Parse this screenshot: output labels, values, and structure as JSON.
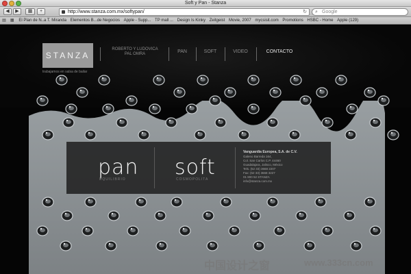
{
  "window": {
    "title": "Soft y Pan - Stanza"
  },
  "toolbar": {
    "url": "http://www.stanza.com.mx/softypan/",
    "search_placeholder": "Google"
  },
  "bookmarks": [
    "El Plan de N..a T. Miranda",
    "Elementos B...de Negocios",
    "Apple - Supp...",
    "TP mall ...",
    "Design Is Kinky",
    "Zeitgeist",
    "Movie, 2007",
    "mycsisit.com",
    "Promotions",
    "HSBC - Home",
    "Apple (129)"
  ],
  "site": {
    "logo": "STANZA",
    "tagline": "trabajamos en salsa de bailar",
    "nav": {
      "item1_line1": "ROBERTO Y LUDOVICA",
      "item1_line2": "PAL OMRA",
      "pan": "PAN",
      "soft": "SOFT",
      "video": "VIDEO",
      "contacto": "CONTACTO"
    },
    "brands": {
      "pan": "pan",
      "pan_sub": "EQUILIBRIO",
      "soft": "soft",
      "soft_sub": "COSMOPOLITA"
    },
    "contact": {
      "company": "Vanguardia Europea, S.A. de C.V.",
      "lines": [
        "Galeno Barreda 164,",
        "Col. San Carlos C.P. 44460",
        "Guadalajara, Jalisco, México",
        "Tels. (52 33) 3668 2207",
        "Fax: (52 33) 3668 3227",
        "01 800 52 STANZA",
        "info@stanza.com.mx"
      ]
    }
  },
  "watermark": {
    "text": "中国设计之窗",
    "url": "www.333cn.com"
  },
  "colors": {
    "page_bg": "#050505",
    "water": "#8a8f92",
    "logo_box": "#9a9a9a",
    "traffic_red": "#e0463f",
    "traffic_yellow": "#e3b23c",
    "traffic_green": "#59b347"
  }
}
